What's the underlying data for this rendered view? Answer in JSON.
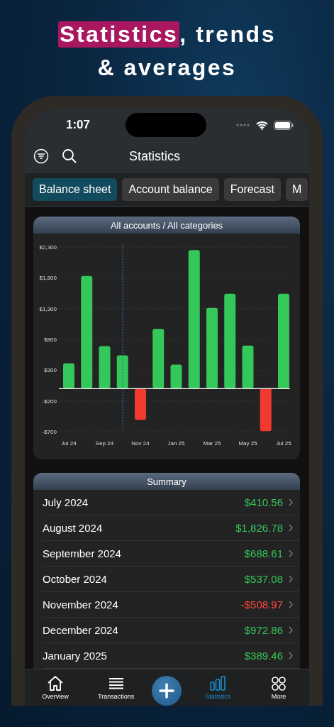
{
  "headline": {
    "highlight": "Statistics",
    "rest": ", trends",
    "line2": "& averages"
  },
  "status_bar": {
    "time": "1:07"
  },
  "nav": {
    "title": "Statistics"
  },
  "segments": [
    {
      "label": "Balance sheet",
      "selected": true
    },
    {
      "label": "Account balance",
      "selected": false
    },
    {
      "label": "Forecast",
      "selected": false
    },
    {
      "label": "M",
      "selected": false
    }
  ],
  "chart_card": {
    "title": "All accounts / All categories",
    "chart_data": {
      "type": "bar",
      "categories": [
        "Jul 24",
        null,
        "Sep 24",
        null,
        "Nov 24",
        null,
        "Jan 25",
        null,
        "Mar 25",
        null,
        "May 25",
        null,
        "Jul 25"
      ],
      "series": [
        {
          "color": "#34c759",
          "values": [
            410,
            1830,
            690,
            540,
            null,
            970,
            390,
            2250,
            1310,
            1540,
            700,
            null,
            1540
          ]
        },
        {
          "color": "#f23a30",
          "values": [
            null,
            null,
            null,
            null,
            -510,
            null,
            null,
            null,
            null,
            null,
            null,
            -690,
            null
          ]
        }
      ],
      "stacked": true,
      "grid": true,
      "ylim": [
        -700,
        2300
      ],
      "yticks": [
        {
          "value": -700,
          "label": "-$700"
        },
        {
          "value": -200,
          "label": "-$200"
        },
        {
          "value": 300,
          "label": "$300"
        },
        {
          "value": 800,
          "label": "$800"
        },
        {
          "value": 1300,
          "label": "$1,300"
        },
        {
          "value": 1800,
          "label": "$1,800"
        },
        {
          "value": 2300,
          "label": "$2,300"
        }
      ]
    }
  },
  "summary": {
    "title": "Summary",
    "rows": [
      {
        "label": "July 2024",
        "amount": "$410.56",
        "color": "#34c759"
      },
      {
        "label": "August 2024",
        "amount": "$1,826.78",
        "color": "#34c759"
      },
      {
        "label": "September 2024",
        "amount": "$688.61",
        "color": "#34c759"
      },
      {
        "label": "October 2024",
        "amount": "$537.08",
        "color": "#34c759"
      },
      {
        "label": "November 2024",
        "amount": "-$508.97",
        "color": "#ff453a"
      },
      {
        "label": "December 2024",
        "amount": "$972.86",
        "color": "#34c759"
      },
      {
        "label": "January 2025",
        "amount": "$389.46",
        "color": "#34c759"
      }
    ]
  },
  "tab_bar": [
    {
      "kind": "home",
      "label": "Overview",
      "selected": false
    },
    {
      "kind": "list",
      "label": "Transactions",
      "selected": false
    },
    {
      "kind": "add"
    },
    {
      "kind": "stats",
      "label": "Statistics",
      "selected": true
    },
    {
      "kind": "more",
      "label": "More",
      "selected": false
    }
  ]
}
